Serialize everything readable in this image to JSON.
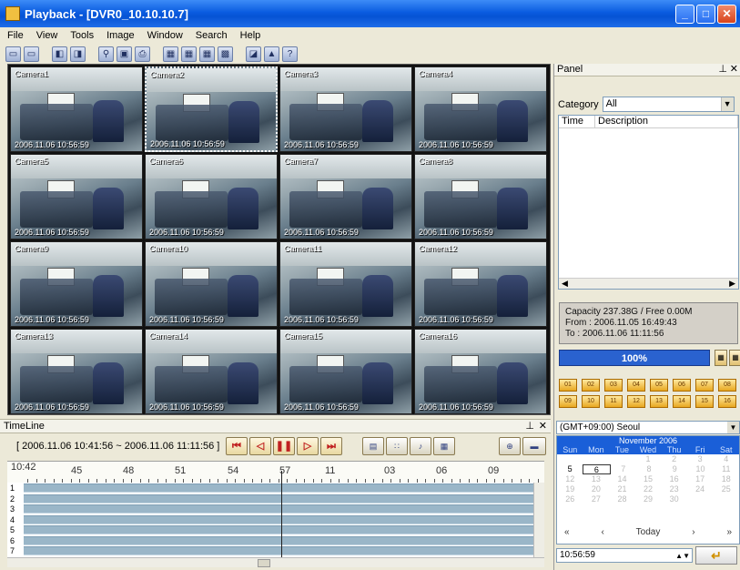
{
  "window": {
    "title": "Playback - [DVR0_10.10.10.7]"
  },
  "menu": [
    "File",
    "View",
    "Tools",
    "Image",
    "Window",
    "Search",
    "Help"
  ],
  "toolbar_icons": [
    "layout-1-icon",
    "layout-2-icon",
    "layout-3-icon",
    "layout-4-icon",
    "search-icon",
    "snapshot-icon",
    "print-icon",
    "split-4-icon",
    "split-9-icon",
    "split-16-icon",
    "split-full-icon",
    "bookmark-icon",
    "export-icon",
    "help-icon"
  ],
  "cameras": [
    {
      "label": "Camera1",
      "stamp": "2006.11.06 10:56:59"
    },
    {
      "label": "Camera2",
      "stamp": "2006.11.06 10:56:59"
    },
    {
      "label": "Camera3",
      "stamp": "2006.11.06 10:56:59"
    },
    {
      "label": "Camera4",
      "stamp": "2006.11.06 10:56:59"
    },
    {
      "label": "Camera5",
      "stamp": "2006.11.06 10:56:59"
    },
    {
      "label": "Camera6",
      "stamp": "2006.11.06 10:56:59"
    },
    {
      "label": "Camera7",
      "stamp": "2006.11.06 10:56:59"
    },
    {
      "label": "Camera8",
      "stamp": "2006.11.06 10:56:59"
    },
    {
      "label": "Camera9",
      "stamp": "2006.11.06 10:56:59"
    },
    {
      "label": "Camera10",
      "stamp": "2006.11.06 10:56:59"
    },
    {
      "label": "Camera11",
      "stamp": "2006.11.06 10:56:59"
    },
    {
      "label": "Camera12",
      "stamp": "2006.11.06 10:56:59"
    },
    {
      "label": "Camera13",
      "stamp": "2006.11.06 10:56:59"
    },
    {
      "label": "Camera14",
      "stamp": "2006.11.06 10:56:59"
    },
    {
      "label": "Camera15",
      "stamp": "2006.11.06 10:56:59"
    },
    {
      "label": "Camera16",
      "stamp": "2006.11.06 10:56:59"
    }
  ],
  "timeline": {
    "title": "TimeLine",
    "range": "[ 2006.11.06 10:41:56 ~ 2006.11.06 11:11:56 ]",
    "ruler_hour": "10:42",
    "ruler_labels": [
      "45",
      "48",
      "51",
      "54",
      "57",
      "11",
      "03",
      "06",
      "09"
    ],
    "track_numbers": [
      "1",
      "2",
      "3",
      "4",
      "5",
      "6",
      "7"
    ]
  },
  "panel": {
    "title": "Panel",
    "category_label": "Category",
    "category_value": "All",
    "columns": [
      "Time",
      "Description"
    ],
    "capacity": "Capacity 237.38G / Free 0.00M",
    "from": "From  : 2006.11.05 16:49:43",
    "to": "To      : 2006.11.06 11:11:56",
    "progress": "100%",
    "progress_value": 1.0,
    "channel_buttons": [
      "01",
      "02",
      "03",
      "04",
      "05",
      "06",
      "07",
      "08",
      "09",
      "10",
      "11",
      "12",
      "13",
      "14",
      "15",
      "16"
    ],
    "timezone": "(GMT+09:00) Seoul",
    "calendar": {
      "month": "November 2006",
      "dow": [
        "Sun",
        "Mon",
        "Tue",
        "Wed",
        "Thu",
        "Fri",
        "Sat"
      ],
      "weeks": [
        [
          "",
          "",
          "",
          "1",
          "2",
          "3",
          "4"
        ],
        [
          "5",
          "6",
          "7",
          "8",
          "9",
          "10",
          "11"
        ],
        [
          "12",
          "13",
          "14",
          "15",
          "16",
          "17",
          "18"
        ],
        [
          "19",
          "20",
          "21",
          "22",
          "23",
          "24",
          "25"
        ],
        [
          "26",
          "27",
          "28",
          "29",
          "30",
          "",
          ""
        ]
      ],
      "today": "Today",
      "selected": "6"
    },
    "time_value": "10:56:59"
  }
}
